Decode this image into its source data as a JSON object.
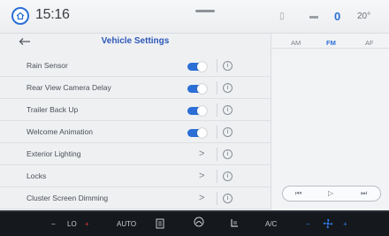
{
  "status": {
    "time": "15:16",
    "temp_setting": "0",
    "outside_temp": "20°",
    "icons": [
      "home-icon",
      "phone-icon",
      "signal-icon"
    ]
  },
  "settings": {
    "title": "Vehicle Settings",
    "rows": [
      {
        "label": "Rain Sensor",
        "control": "toggle",
        "on": true
      },
      {
        "label": "Rear View Camera Delay",
        "control": "toggle",
        "on": true
      },
      {
        "label": "Trailer Back Up",
        "control": "toggle",
        "on": true
      },
      {
        "label": "Welcome Animation",
        "control": "toggle",
        "on": true
      },
      {
        "label": "Exterior Lighting",
        "control": "chevron",
        "chevron": ">"
      },
      {
        "label": "Locks",
        "control": "chevron",
        "chevron": ">"
      },
      {
        "label": "Cluster Screen Dimming",
        "control": "chevron",
        "chevron": ">"
      }
    ]
  },
  "media": {
    "bands": [
      "AM",
      "FM",
      "AF"
    ],
    "active_band": "FM",
    "controls": [
      "⏮",
      "▷",
      "⏭"
    ]
  },
  "climate": {
    "left_minus": "−",
    "left_label": "LO",
    "left_plus": "+",
    "auto": "AUTO",
    "ac": "A/C",
    "right_minus": "−",
    "right_plus": "+"
  },
  "colors": {
    "accent": "#2b6fd6",
    "title": "#2f58b8",
    "climate_bg": "#15181c",
    "red": "#e0403f"
  }
}
